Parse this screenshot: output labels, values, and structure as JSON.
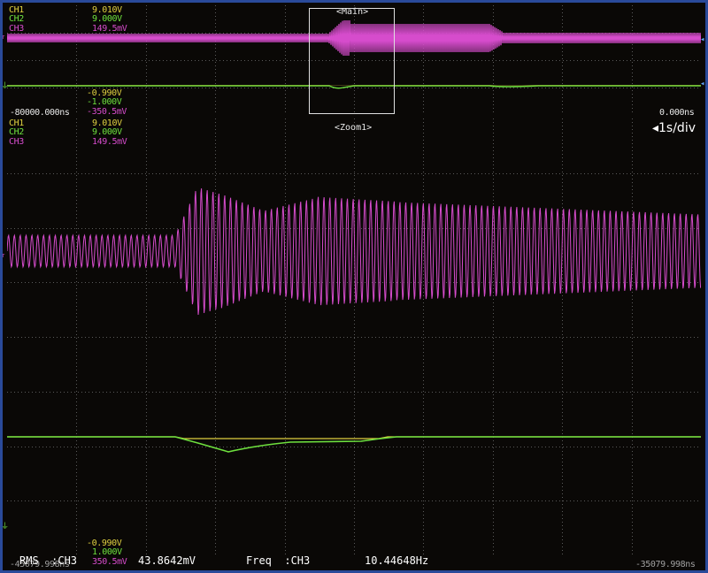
{
  "channels_top": [
    {
      "name": "CH1",
      "value": "9.010V"
    },
    {
      "name": "CH2",
      "value": "9.000V"
    },
    {
      "name": "CH3",
      "value": "149.5mV"
    }
  ],
  "channels_bottom_main": [
    {
      "name": "CH1",
      "value": "-0.990V"
    },
    {
      "name": "CH2",
      "value": "-1.000V"
    },
    {
      "name": "CH3",
      "value": "-350.5mV"
    }
  ],
  "channels_zoom_top": [
    {
      "name": "CH1",
      "value": "9.010V"
    },
    {
      "name": "CH2",
      "value": "9.000V"
    },
    {
      "name": "CH3",
      "value": "149.5mV"
    }
  ],
  "channels_zoom_bottom": [
    {
      "name": "CH1",
      "value": "-0.990V"
    },
    {
      "name": "CH2",
      "value": "1.000V"
    },
    {
      "name": "CH3",
      "value": "350.5mV"
    }
  ],
  "main": {
    "title": "<Main>",
    "time_left": "-80000.000ns",
    "time_right": "0.000ns"
  },
  "zoom": {
    "title": "<Zoom1>",
    "timebase": "◂1s/div",
    "time_left": "-45079.998ns",
    "time_right": "-35079.998ns"
  },
  "measurements": {
    "rms_label": "RMS  :CH3",
    "rms_value": "43.8642mV",
    "freq_label": "Freq  :CH3",
    "freq_value": "10.44648Hz"
  },
  "colors": {
    "ch1": "#e0d040",
    "ch2": "#6ee03e",
    "ch3": "#d64ccc",
    "grid": "#5a5a5a",
    "frame": "#2a4a9a"
  },
  "markers": {
    "level": "ᵀ",
    "ground": "⏚"
  }
}
